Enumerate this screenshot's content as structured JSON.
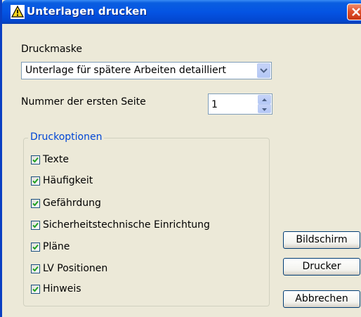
{
  "window": {
    "title": "Unterlagen drucken"
  },
  "druckmaske": {
    "label": "Druckmaske",
    "selected": "Unterlage für spätere Arbeiten detailliert"
  },
  "nummer": {
    "label": "Nummer der ersten Seite",
    "value": "1"
  },
  "druckoptionen": {
    "legend": "Druckoptionen",
    "options": [
      {
        "label": "Texte",
        "checked": true
      },
      {
        "label": "Häufigkeit",
        "checked": true
      },
      {
        "label": "Gefährdung",
        "checked": true
      },
      {
        "label": "Sicherheitstechnische Einrichtung",
        "checked": true
      },
      {
        "label": "Pläne",
        "checked": true
      },
      {
        "label": "LV Positionen",
        "checked": true
      },
      {
        "label": "Hinweis",
        "checked": true
      }
    ]
  },
  "buttons": {
    "bildschirm": "Bildschirm",
    "drucker": "Drucker",
    "abbrechen": "Abbrechen"
  },
  "colors": {
    "titlebar": "#0454e3",
    "dialog_bg": "#ece9d8",
    "groupbox_legend": "#0046d5",
    "close_button": "#e0502c",
    "checkmark": "#21a121"
  }
}
